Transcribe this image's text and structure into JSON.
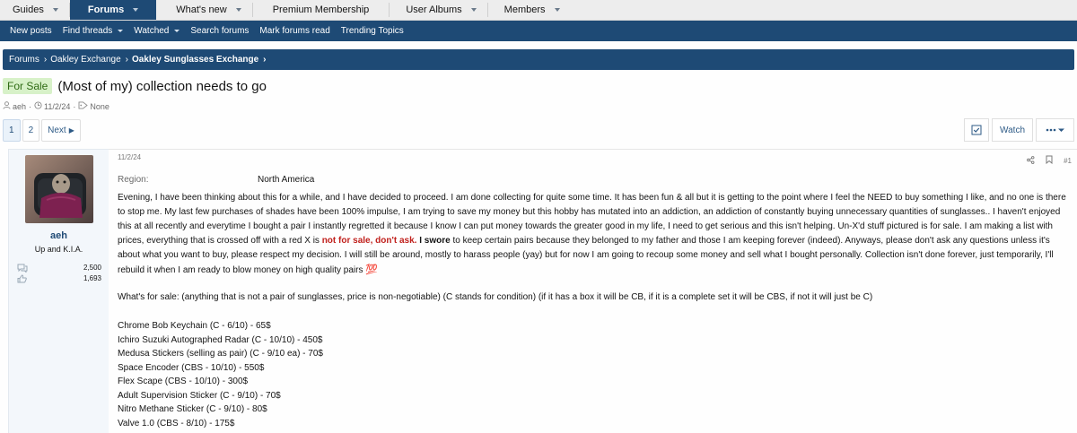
{
  "topnav": [
    {
      "label": "Guides",
      "caret": true,
      "active": false
    },
    {
      "label": "Forums",
      "caret": true,
      "active": true
    },
    {
      "label": "What's new",
      "caret": true,
      "active": false
    },
    {
      "label": "Premium Membership",
      "caret": false,
      "active": false
    },
    {
      "label": "User Albums",
      "caret": true,
      "active": false
    },
    {
      "label": "Members",
      "caret": true,
      "active": false
    }
  ],
  "subnav": [
    {
      "label": "New posts",
      "caret": false
    },
    {
      "label": "Find threads",
      "caret": true
    },
    {
      "label": "Watched",
      "caret": true
    },
    {
      "label": "Search forums",
      "caret": false
    },
    {
      "label": "Mark forums read",
      "caret": false
    },
    {
      "label": "Trending Topics",
      "caret": false
    }
  ],
  "breadcrumb": [
    "Forums",
    "Oakley Exchange",
    "Oakley Sunglasses Exchange"
  ],
  "thread": {
    "prefix": "For Sale",
    "title": "(Most of my) collection needs to go",
    "author": "aeh",
    "date": "11/2/24",
    "tags": "None"
  },
  "pager": {
    "pages": [
      "1",
      "2"
    ],
    "next": "Next"
  },
  "actions": {
    "watch": "Watch"
  },
  "post": {
    "date": "11/2/24",
    "number": "#1",
    "user": {
      "name": "aeh",
      "title": "Up and K.I.A.",
      "messages": "2,500",
      "reactions": "1,693"
    },
    "region_label": "Region:",
    "region_value": "North America",
    "p1": "Evening, I have been thinking about this for a while, and I have decided to proceed. I am done collecting for quite some time. It has been fun & all but it is getting to the point where I feel the NEED to buy something I like, and no one is there to stop me. My last few purchases of shades have been 100% impulse, I am trying to save my money but this hobby has mutated into an addiction, an addiction of constantly buying unnecessary quantities of sunglasses.. I haven't enjoyed this at all recently and everytime I bought a pair I instantly regretted it because I know I can put money towards the greater good in my life, I need to get serious and this isn't helping. Un-X'd stuff pictured is for sale. I am making a list with prices, everything that is crossed off with a red X is",
    "p1_red": "not for sale, don't ask.",
    "p1_bold": "I swore",
    "p1_tail": "to keep certain pairs because they belonged to my father and those I am keeping forever (indeed). Anyways, please don't ask any questions unless it's about what you want to buy, please respect my decision. I will still be around, mostly to harass people (yay) but for now I am going to recoup some money and sell what I bought personally. Collection isn't done forever, just temporarily, I'll rebuild it when I am ready to blow money on high quality pairs",
    "emoji": "💯",
    "forsale": "What's for sale: (anything that is not a pair of sunglasses, price is non-negotiable) (C stands for condition) (if it has a box it will be CB, if it is a complete set it will be CBS, if not it will just be C)",
    "items": [
      "Chrome Bob Keychain (C - 6/10) - 65$",
      "Ichiro Suzuki Autographed Radar (C - 10/10) - 450$",
      "Medusa Stickers (selling as pair) (C - 9/10 ea) - 70$",
      "Space Encoder (CBS - 10/10) - 550$",
      "Flex Scape (CBS - 10/10) - 300$",
      "Adult Supervision Sticker (C - 9/10) - 70$",
      "Nitro Methane Sticker (C - 9/10) - 80$",
      "Valve 1.0 (CBS - 8/10) - 175$"
    ]
  }
}
